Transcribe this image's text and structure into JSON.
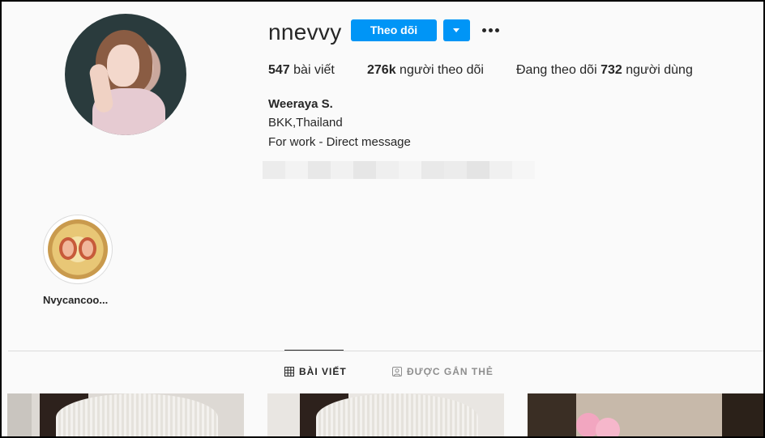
{
  "profile": {
    "username": "nnevvy",
    "follow_label": "Theo dõi",
    "stats": {
      "posts_count": "547",
      "posts_label": "bài viết",
      "followers_count": "276k",
      "followers_label": "người theo dõi",
      "following_prefix": "Đang theo dõi",
      "following_count": "732",
      "following_suffix": "người dùng"
    },
    "bio": {
      "name": "Weeraya S.",
      "location": "BKK,Thailand",
      "note": "For work - Direct message"
    }
  },
  "highlights": [
    {
      "label": "Nvycancoo..."
    }
  ],
  "tabs": [
    {
      "label": "BÀI VIẾT",
      "icon": "grid-icon",
      "active": true
    },
    {
      "label": "ĐƯỢC GẮN THẺ",
      "icon": "tagged-icon",
      "active": false
    }
  ],
  "colors": {
    "accent": "#0095f6",
    "text": "#262626",
    "muted": "#8e8e8e",
    "border": "#dbdbdb"
  }
}
